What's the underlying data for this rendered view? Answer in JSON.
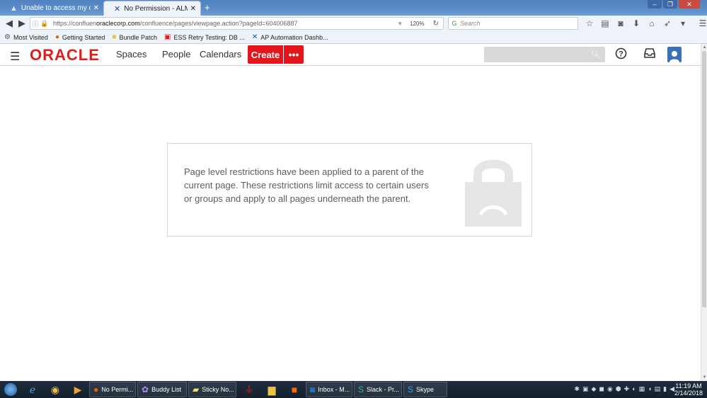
{
  "browser": {
    "tabs": [
      {
        "title": "Unable to access my confl...",
        "icon": "confluence-icon",
        "active": false
      },
      {
        "title": "No Permission - ALM Confl...",
        "icon": "confluence-x-icon",
        "active": true
      }
    ],
    "new_tab": "+",
    "url_prefix": "https://confluen",
    "url_host": "oraclecorp.com",
    "url_path": "/confluence/pages/viewpage.action?pageId=604006887",
    "zoom": "120%",
    "search_placeholder": "Search",
    "bookmarks": [
      {
        "label": "Most Visited",
        "icon": "gear-icon"
      },
      {
        "label": "Getting Started",
        "icon": "firefox-icon"
      },
      {
        "label": "Bundle Patch",
        "icon": "folder-icon"
      },
      {
        "label": "ESS Retry Testing: DB ...",
        "icon": "oracle-icon"
      },
      {
        "label": "AP Automation Dashb...",
        "icon": "confluence-x-icon"
      }
    ]
  },
  "app": {
    "logo": "ORACLE",
    "nav": [
      "Spaces",
      "People",
      "Calendars"
    ],
    "create_label": "Create",
    "more_label": "•••"
  },
  "main": {
    "message": "Page level restrictions have been applied to a parent of the current page. These restrictions limit access to certain users or groups and apply to all pages underneath the parent."
  },
  "taskbar": {
    "tasks": [
      {
        "label": "No Permi...",
        "icon": "firefox-icon"
      },
      {
        "label": "Buddy List",
        "icon": "pidgin-icon"
      },
      {
        "label": "Sticky No...",
        "icon": "sticky-notes-icon"
      },
      {
        "label": "",
        "icon": "acrobat-icon"
      },
      {
        "label": "",
        "icon": "explorer-folder-icon"
      },
      {
        "label": "",
        "icon": "mi-icon"
      },
      {
        "label": "Inbox - M...",
        "icon": "outlook-icon"
      },
      {
        "label": "Slack - Pr...",
        "icon": "slack-icon"
      },
      {
        "label": "Skype",
        "icon": "skype-icon"
      }
    ],
    "time": "11:19 AM",
    "date": "2/14/2018"
  },
  "colors": {
    "brand_red": "#e4161c",
    "tab_strip": "#5d8ec9",
    "message_text": "#5d5d5d",
    "lock_gray": "#e6e6e6"
  }
}
